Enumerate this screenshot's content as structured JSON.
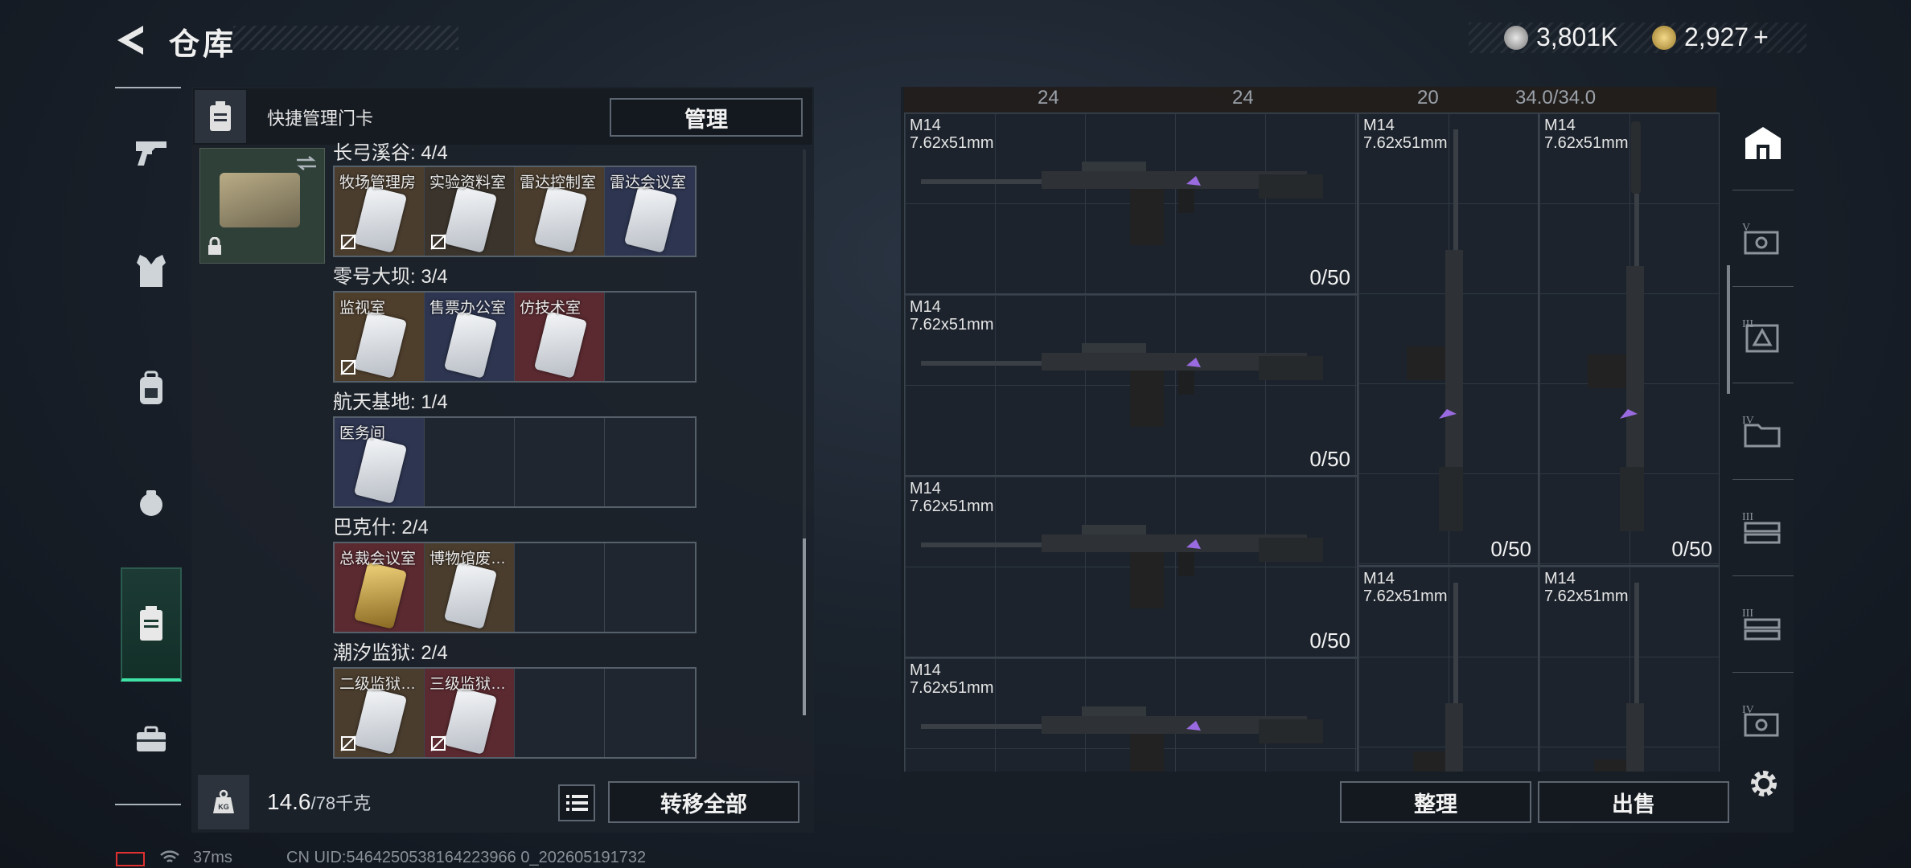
{
  "header": {
    "title": "仓库",
    "currency1": "3,801K",
    "currency2": "2,927",
    "add": "+"
  },
  "keycard_panel": {
    "header_label": "快捷管理门卡",
    "manage_button": "管理",
    "top_partial_title": "长弓溪谷: 4/4",
    "sections": [
      {
        "title": "零号大坝: 3/4"
      },
      {
        "title": "航天基地: 1/4"
      },
      {
        "title": "巴克什: 2/4"
      },
      {
        "title": "潮汐监狱: 2/4"
      }
    ],
    "row0": [
      "牧场管理房",
      "实验资料室",
      "雷达控制室",
      "雷达会议室"
    ],
    "row1": [
      "监视室",
      "售票办公室",
      "仿技术室"
    ],
    "row2": [
      "医务间"
    ],
    "row3": [
      "总裁会议室",
      "博物馆废…"
    ],
    "row4": [
      "二级监狱…",
      "三级监狱…"
    ],
    "weight_current": "14.6",
    "weight_max": "/78千克",
    "transfer_all": "转移全部"
  },
  "weapons": {
    "cap1": "24",
    "cap2": "24",
    "cap3": "20",
    "capacity": "34.0/34.0",
    "items": [
      {
        "name": "M14",
        "caliber": "7.62x51mm",
        "ammo": "0/50"
      },
      {
        "name": "M14",
        "caliber": "7.62x51mm",
        "ammo": "0/50"
      },
      {
        "name": "M14",
        "caliber": "7.62x51mm",
        "ammo": "0/50"
      },
      {
        "name": "M14",
        "caliber": "7.62x51mm",
        "ammo": ""
      },
      {
        "name": "M14",
        "caliber": "7.62x51mm",
        "ammo": "0/50"
      },
      {
        "name": "M14",
        "caliber": "7.62x51mm",
        "ammo": "0/50"
      },
      {
        "name": "M14",
        "caliber": "7.62x51mm",
        "ammo": ""
      },
      {
        "name": "M14",
        "caliber": "7.62x51mm",
        "ammo": ""
      }
    ],
    "sort_button": "整理",
    "sell_button": "出售"
  },
  "right_tabs": [
    "home-tab",
    "V",
    "III",
    "IV",
    "III",
    "III",
    "IV"
  ],
  "status": {
    "ping": "37ms",
    "uid": "CN UID:5464250538164223966 0_202605191732"
  },
  "colors": {
    "accent": "#3fe3a6",
    "panel": "#1c232c",
    "red_card": "#5a2a30",
    "brown_card": "#5a4530",
    "blue_card": "#2d3550"
  }
}
